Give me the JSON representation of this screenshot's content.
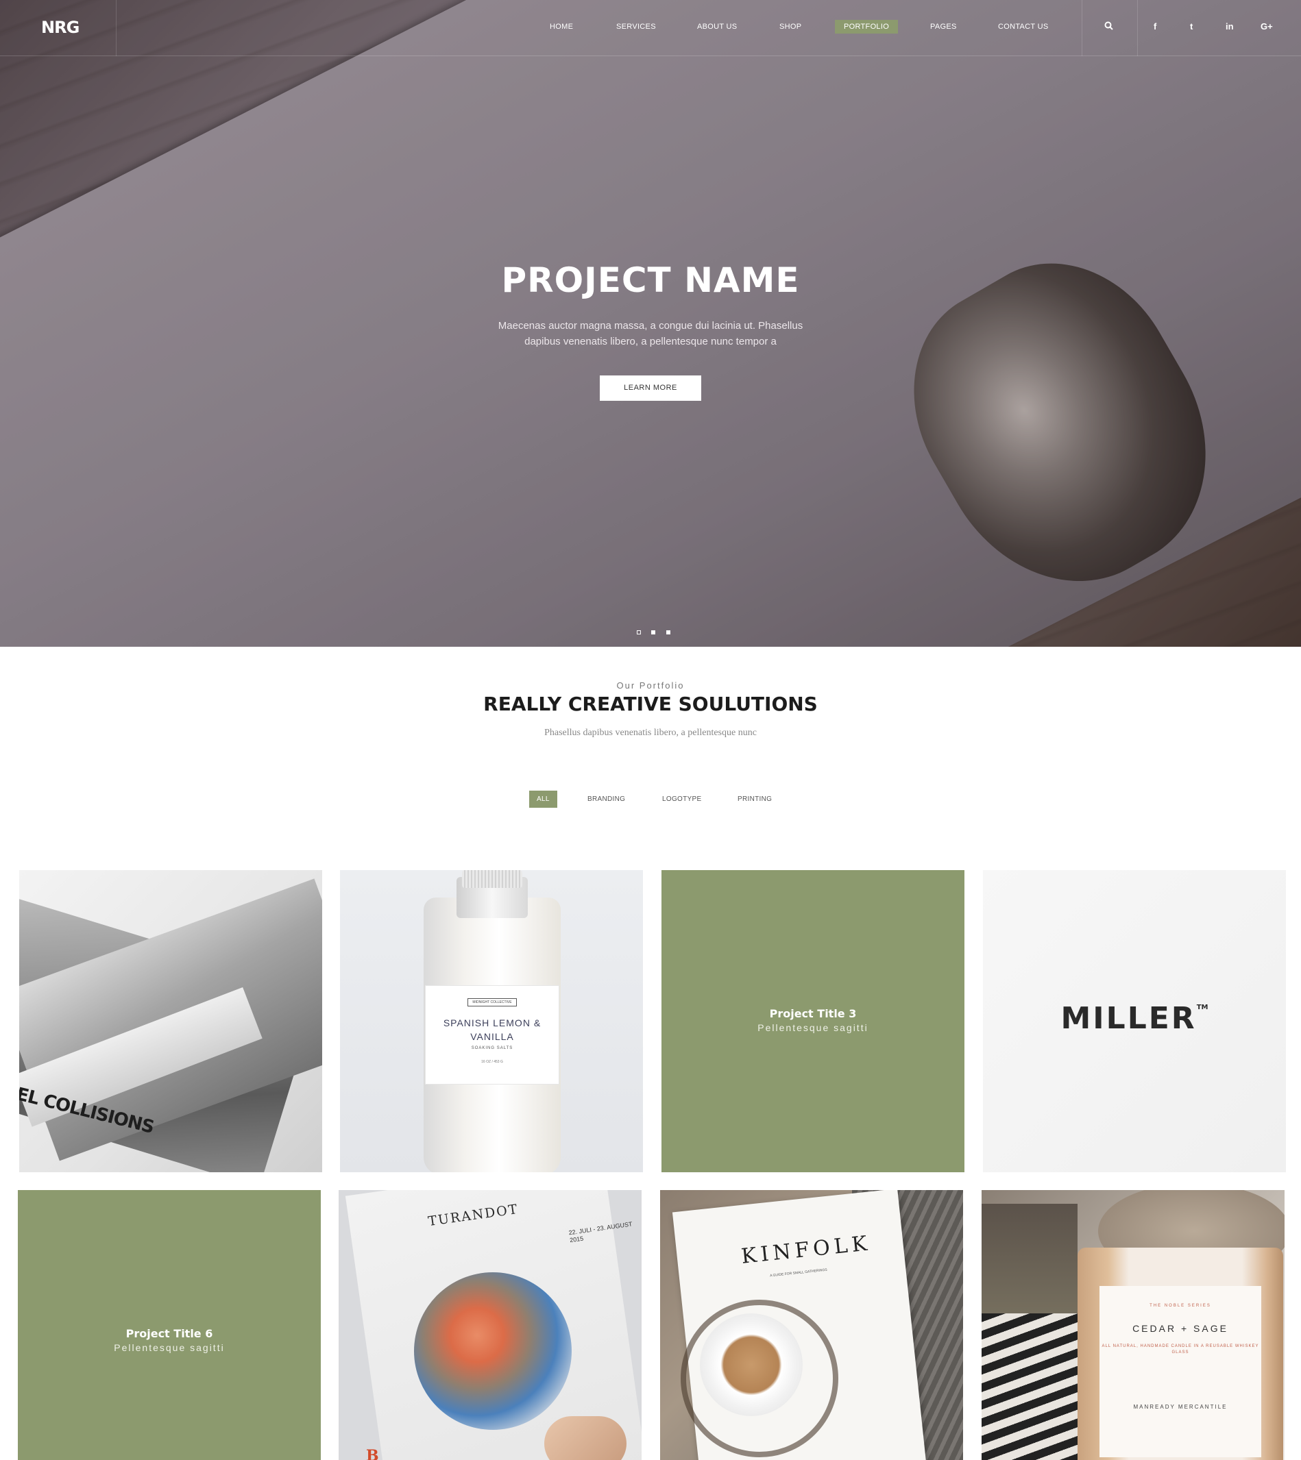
{
  "nav": {
    "logo": "NRG",
    "items": [
      {
        "label": "HOME"
      },
      {
        "label": "SERVICES"
      },
      {
        "label": "ABOUT US"
      },
      {
        "label": "SHOP"
      },
      {
        "label": "PORTFOLIO",
        "active": true
      },
      {
        "label": "PAGES"
      },
      {
        "label": "CONTACT US"
      }
    ],
    "icons": [
      "search-icon",
      "facebook-icon",
      "twitter-icon",
      "linkedin-icon",
      "google-plus-icon"
    ],
    "icon_glyphs": {
      "facebook": "f",
      "twitter": "t",
      "linkedin": "in",
      "google_plus": "G+"
    }
  },
  "hero": {
    "title": "PROJECT NAME",
    "description": "Maecenas auctor magna massa, a congue dui lacinia ut. Phasellus dapibus venenatis libero, a pellentesque nunc tempor a",
    "button": "LEARN MORE",
    "slides": 3,
    "active_slide": 1
  },
  "portfolio": {
    "subtitle": "Our Portfolio",
    "title": "REALLY CREATIVE SOULUTIONS",
    "description": "Phasellus dapibus venenatis libero, a pellentesque nunc",
    "filters": [
      {
        "label": "ALL",
        "active": true
      },
      {
        "label": "BRANDING"
      },
      {
        "label": "LOGOTYPE"
      },
      {
        "label": "PRINTING"
      }
    ],
    "items": [
      {
        "type": "image",
        "name": "book",
        "text": "EL COLLISIONS"
      },
      {
        "type": "image",
        "name": "bottle",
        "label_tag": "MIDNIGHT COLLECTIVE",
        "label_title": "SPANISH LEMON & VANILLA",
        "label_sub": "SOAKING SALTS",
        "label_size": "16 OZ / 453 G"
      },
      {
        "type": "hover",
        "title": "Project Title 3",
        "subtitle": "Pellentesque sagitti"
      },
      {
        "type": "image",
        "name": "miller-logo",
        "text": "MILLER",
        "mark": "TM"
      },
      {
        "type": "hover",
        "title": "Project Title 6",
        "subtitle": "Pellentesque sagitti"
      },
      {
        "type": "image",
        "name": "newspaper",
        "title": "TURANDOT",
        "date": "22. JULI - 23. AUGUST 2015",
        "letter": "B"
      },
      {
        "type": "image",
        "name": "kinfolk",
        "title": "KINFOLK",
        "subtitle": "A GUIDE FOR SMALL GATHERINGS"
      },
      {
        "type": "image",
        "name": "candle",
        "series": "THE NOBLE SERIES",
        "title": "CEDAR + SAGE",
        "desc": "ALL NATURAL, HANDMADE CANDLE IN A REUSABLE WHISKEY GLASS",
        "maker": "MANREADY MERCANTILE"
      }
    ]
  },
  "colors": {
    "accent": "#8c9a6e",
    "text_dark": "#1c1c1c",
    "text_muted": "#888888"
  }
}
